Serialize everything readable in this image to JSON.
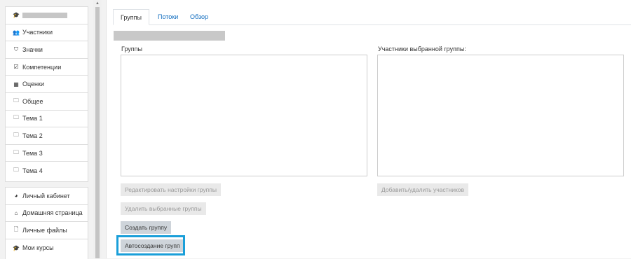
{
  "sidebar": {
    "top_items": [
      {
        "label": "Участники",
        "icon": "users-icon",
        "glyph": "👥"
      },
      {
        "label": "Значки",
        "icon": "shield-icon",
        "glyph": "⛉"
      },
      {
        "label": "Компетенции",
        "icon": "check-square-icon",
        "glyph": "☑"
      },
      {
        "label": "Оценки",
        "icon": "table-icon",
        "glyph": "▦"
      },
      {
        "label": "Общее",
        "icon": "folder-icon",
        "glyph": "🗀"
      },
      {
        "label": "Тема 1",
        "icon": "folder-icon",
        "glyph": "🗀"
      },
      {
        "label": "Тема 2",
        "icon": "folder-icon",
        "glyph": "🗀"
      },
      {
        "label": "Тема 3",
        "icon": "folder-icon",
        "glyph": "🗀"
      },
      {
        "label": "Тема 4",
        "icon": "folder-icon",
        "glyph": "🗀"
      }
    ],
    "bottom_items": [
      {
        "label": "Личный кабинет",
        "icon": "dashboard-icon",
        "glyph": "◕"
      },
      {
        "label": "Домашняя страница",
        "icon": "home-icon",
        "glyph": "⌂"
      },
      {
        "label": "Личные файлы",
        "icon": "file-icon",
        "glyph": "🗋"
      },
      {
        "label": "Мои курсы",
        "icon": "graduation-cap-icon",
        "glyph": "🎓"
      }
    ]
  },
  "tabs": [
    {
      "label": "Группы",
      "active": true
    },
    {
      "label": "Потоки",
      "active": false
    },
    {
      "label": "Обзор",
      "active": false
    }
  ],
  "groups_panel": {
    "label": "Группы"
  },
  "members_panel": {
    "label": "Участники выбранной группы:"
  },
  "buttons": {
    "edit_group": "Редактировать настройки группы",
    "delete_groups": "Удалить выбранные группы",
    "create_group": "Создать группу",
    "auto_create": "Автосоздание групп",
    "add_remove_members": "Добавить/удалить участников"
  },
  "colors": {
    "accent_link": "#0f6cbf",
    "highlight_frame": "#1a9fd9"
  }
}
